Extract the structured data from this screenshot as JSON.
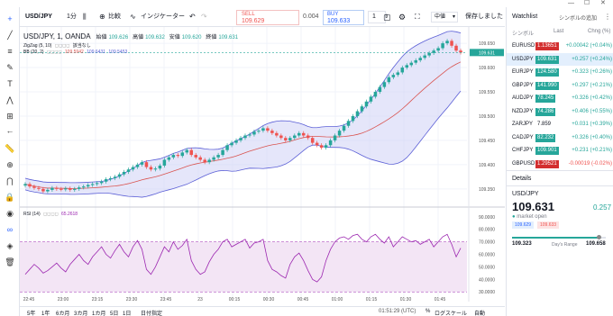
{
  "window": {
    "minimize": "—",
    "maximize": "☐",
    "close": "✕"
  },
  "toolbar": {
    "symbol": "USD/JPY",
    "interval": "1分",
    "compare": "比較",
    "indicators": "インジケーター",
    "order_type": "中値",
    "save": "保存しました"
  },
  "trade": {
    "sell_label": "SELL",
    "sell_price": "109.629",
    "spread": "0.004",
    "buy_label": "BUY",
    "buy_price": "109.633",
    "quantity": "1"
  },
  "legend": {
    "title": "USD/JPY, 1, OANDA",
    "open_label": "始値",
    "open": "109.626",
    "high_label": "高値",
    "high": "109.632",
    "low_label": "安値",
    "low": "109.620",
    "close_label": "終値",
    "close": "109.631",
    "zigzag": "ZigZag (5, 10)",
    "zigzag_value": "該当なし",
    "bb": "BB (20, 2)",
    "bb_v1": "109.5942",
    "bb_v2": "109.6431",
    "bb_v3": "109.5453",
    "rsi": "RSI (14)",
    "rsi_value": "65.2618"
  },
  "price_axis": [
    "109.650",
    "109.600",
    "109.550",
    "109.500",
    "109.450",
    "109.400",
    "109.350"
  ],
  "price_tags": {
    "last": "109.631",
    "top": "109.650"
  },
  "rsi_axis": [
    "90.0000",
    "80.0000",
    "70.0000",
    "60.0000",
    "50.0000",
    "40.0000",
    "30.0000"
  ],
  "time_axis": [
    "22:45",
    "23:00",
    "23:15",
    "23:30",
    "23:45",
    "23",
    "00:15",
    "00:30",
    "00:45",
    "01:00",
    "01:15",
    "01:30",
    "01:45"
  ],
  "status": {
    "ranges": [
      "5y",
      "1y",
      "6mo",
      "3mo",
      "1mo",
      "5d",
      "1d"
    ],
    "range_labels": [
      "5年",
      "1年",
      "6カ月",
      "3カ月",
      "1カ月",
      "5日",
      "1日"
    ],
    "goto": "日付指定",
    "clock": "01:51:29 (UTC)",
    "percent": "%",
    "log": "ログスケール",
    "auto": "自動"
  },
  "watchlist": {
    "tab": "Watchlist",
    "add": "シンボルの追加",
    "col_symbol": "シンボル",
    "col_last": "Last",
    "col_chg": "Chng (%)",
    "rows": [
      {
        "symbol": "EURUSD",
        "last": "1.13651",
        "chg": "+0.00042 (+0.04%)",
        "dir": "down"
      },
      {
        "symbol": "USDJPY",
        "last": "109.631",
        "chg": "+0.257 (+0.24%)",
        "dir": "up"
      },
      {
        "symbol": "EURJPY",
        "last": "124.580",
        "chg": "+0.323 (+0.26%)",
        "dir": "up"
      },
      {
        "symbol": "GBPJPY",
        "last": "141.990",
        "chg": "+0.297 (+0.21%)",
        "dir": "up"
      },
      {
        "symbol": "AUDJPY",
        "last": "78.245",
        "chg": "+0.326 (+0.42%)",
        "dir": "up"
      },
      {
        "symbol": "NZDJPY",
        "last": "74.286",
        "chg": "+0.406 (+0.55%)",
        "dir": "up"
      },
      {
        "symbol": "ZARJPY",
        "last": "7.859",
        "chg": "+0.031 (+0.39%)",
        "dir": "none"
      },
      {
        "symbol": "CADJPY",
        "last": "82.232",
        "chg": "+0.326 (+0.40%)",
        "dir": "up"
      },
      {
        "symbol": "CHFJPY",
        "last": "109.901",
        "chg": "+0.231 (+0.21%)",
        "dir": "up"
      },
      {
        "symbol": "GBPUSD",
        "last": "1.29521",
        "chg": "-0.00019 (-0.02%)",
        "dir": "down"
      }
    ]
  },
  "details": {
    "header": "Details",
    "symbol": "USD/JPY",
    "price": "109.631",
    "change": "0.257",
    "market": "market open",
    "bid": "109.629",
    "ask": "109.633",
    "low": "109.323",
    "high": "109.658",
    "range_label": "Day's Range"
  },
  "colors": {
    "up": "#26a69a",
    "down": "#ef5350",
    "band_fill": "#cfd1f5",
    "band_line": "#5b5fd6",
    "basis": "#d9534f",
    "rsi_line": "#9c27b0",
    "rsi_fill": "#f3e5f5",
    "accent": "#2962ff"
  },
  "chart_data": {
    "type": "candlestick",
    "title": "USD/JPY, 1, OANDA",
    "price_ylim": [
      109.32,
      109.665
    ],
    "rsi_ylim": [
      28,
      92
    ],
    "rsi_bands": [
      30,
      70
    ],
    "close_series": [
      109.36,
      109.355,
      109.352,
      109.35,
      109.345,
      109.348,
      109.352,
      109.35,
      109.349,
      109.351,
      109.348,
      109.35,
      109.353,
      109.355,
      109.358,
      109.36,
      109.362,
      109.365,
      109.37,
      109.372,
      109.375,
      109.38,
      109.385,
      109.39,
      109.395,
      109.4,
      109.405,
      109.395,
      109.39,
      109.392,
      109.398,
      109.41,
      109.415,
      109.42,
      109.418,
      109.425,
      109.43,
      109.42,
      109.415,
      109.41,
      109.405,
      109.41,
      109.415,
      109.42,
      109.43,
      109.44,
      109.445,
      109.45,
      109.455,
      109.46,
      109.462,
      109.468,
      109.47,
      109.475,
      109.47,
      109.465,
      109.46,
      109.455,
      109.45,
      109.455,
      109.46,
      109.465,
      109.46,
      109.455,
      109.445,
      109.44,
      109.435,
      109.44,
      109.45,
      109.46,
      109.47,
      109.48,
      109.49,
      109.5,
      109.51,
      109.52,
      109.53,
      109.54,
      109.55,
      109.56,
      109.57,
      109.58,
      109.585,
      109.59,
      109.6,
      109.605,
      109.61,
      109.615,
      109.62,
      109.625,
      109.63,
      109.635,
      109.64,
      109.65,
      109.655,
      109.645,
      109.635,
      109.631
    ],
    "rsi_series": [
      44,
      48,
      52,
      49,
      45,
      47,
      50,
      53,
      49,
      46,
      52,
      56,
      60,
      55,
      52,
      58,
      62,
      66,
      60,
      57,
      63,
      68,
      62,
      58,
      66,
      71,
      64,
      48,
      44,
      50,
      58,
      66,
      62,
      70,
      64,
      67,
      72,
      55,
      48,
      44,
      46,
      54,
      60,
      64,
      70,
      72,
      66,
      68,
      70,
      72,
      65,
      69,
      70,
      72,
      55,
      48,
      46,
      43,
      41,
      52,
      58,
      61,
      55,
      47,
      40,
      38,
      42,
      55,
      64,
      70,
      73,
      74,
      72,
      75,
      76,
      72,
      70,
      74,
      76,
      72,
      69,
      74,
      66,
      70,
      74,
      72,
      70,
      71,
      68,
      70,
      72,
      66,
      70,
      74,
      76,
      68,
      58,
      65
    ]
  }
}
